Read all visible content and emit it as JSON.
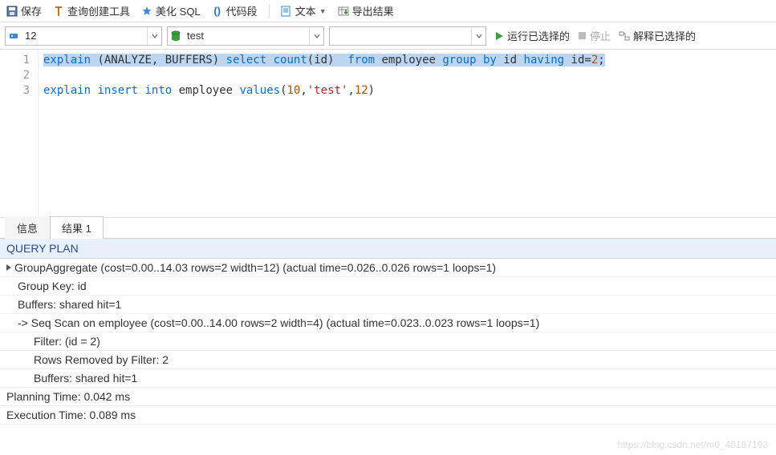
{
  "toolbar": {
    "save": "保存",
    "query_builder": "查询创建工具",
    "beautify": "美化 SQL",
    "snippet": "代码段",
    "text": "文本",
    "export": "导出结果"
  },
  "secondbar": {
    "combo1_value": "12",
    "combo2_value": "test",
    "combo3_value": "",
    "run": "运行已选择的",
    "stop": "停止",
    "explain": "解释已选择的"
  },
  "editor": {
    "lines": {
      "l1": {
        "num": "1"
      },
      "l2": {
        "num": "2"
      },
      "l3": {
        "num": "3"
      }
    },
    "line1_tokens": {
      "a": "explain",
      "b": " (ANALYZE, BUFFERS) ",
      "c": "select",
      "d": " ",
      "e": "count",
      "f": "(id)  ",
      "g": "from",
      "h": " employee ",
      "i": "group",
      "j": " ",
      "k": "by",
      "l": " id ",
      "m": "having",
      "n": " id=",
      "o": "2",
      "p": ";"
    },
    "line3_tokens": {
      "a": "explain",
      "b": " ",
      "c": "insert",
      "d": " ",
      "e": "into",
      "f": " employee ",
      "g": "values",
      "h": "(",
      "i": "10",
      "j": ",",
      "k": "'test'",
      "l": ",",
      "m": "12",
      "n": ")"
    }
  },
  "tabs": {
    "info": "信息",
    "result1": "结果 1"
  },
  "qp": {
    "header": "QUERY PLAN",
    "rows": {
      "r0": "GroupAggregate  (cost=0.00..14.03 rows=2 width=12) (actual time=0.026..0.026 rows=1 loops=1)",
      "r1": "Group Key: id",
      "r2": "Buffers: shared hit=1",
      "r3": "->  Seq Scan on employee  (cost=0.00..14.00 rows=2 width=4) (actual time=0.023..0.023 rows=1 loops=1)",
      "r4": "Filter: (id = 2)",
      "r5": "Rows Removed by Filter: 2",
      "r6": "Buffers: shared hit=1",
      "r7": "Planning Time: 0.042 ms",
      "r8": "Execution Time: 0.089 ms"
    }
  },
  "watermark": "https://blog.csdn.net/m0_48187193"
}
